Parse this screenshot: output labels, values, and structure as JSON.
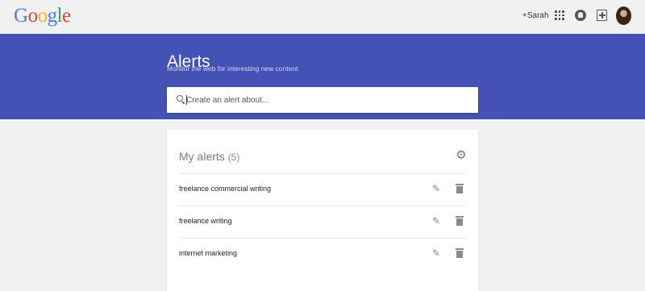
{
  "header": {
    "logo": [
      "G",
      "o",
      "o",
      "g",
      "l",
      "e"
    ],
    "user_link": "+Sarah",
    "icons": [
      "apps-icon",
      "notifications-icon",
      "share-icon",
      "avatar"
    ]
  },
  "hero": {
    "title": "Alerts",
    "subtitle": "Monitor the web for interesting new content",
    "background_color": "#4451b5",
    "search": {
      "placeholder": "Create an alert about...",
      "value": ""
    }
  },
  "my_alerts": {
    "title": "My alerts",
    "count": "(5)",
    "items": [
      {
        "label": "freelance commercial writing"
      },
      {
        "label": "freelance writing"
      },
      {
        "label": "internet marketing"
      }
    ]
  }
}
